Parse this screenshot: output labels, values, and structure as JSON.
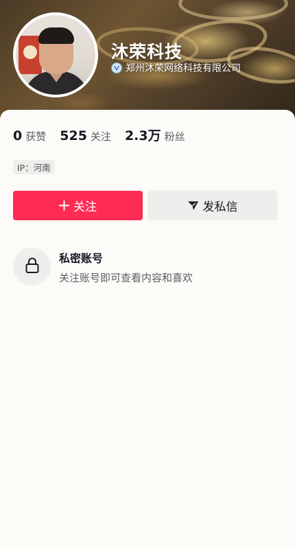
{
  "profile": {
    "name": "沐荣科技",
    "verified_label": "郑州沐荣网络科技有限公司",
    "avatar": "avatar-photo"
  },
  "stats": [
    {
      "value": "0",
      "label": "获赞"
    },
    {
      "value": "525",
      "label": "关注"
    },
    {
      "value": "2.3万",
      "label": "粉丝"
    }
  ],
  "ip_location": "IP：河南",
  "actions": {
    "follow_label": "关注",
    "message_label": "发私信"
  },
  "private_notice": {
    "title": "私密账号",
    "description": "关注账号即可查看内容和喜欢"
  },
  "colors": {
    "accent": "#fe2c55",
    "background": "#fcfbf8",
    "button_secondary": "#efeeec"
  },
  "icons": [
    "verified-badge-icon",
    "plus-icon",
    "send-icon",
    "lock-icon"
  ]
}
